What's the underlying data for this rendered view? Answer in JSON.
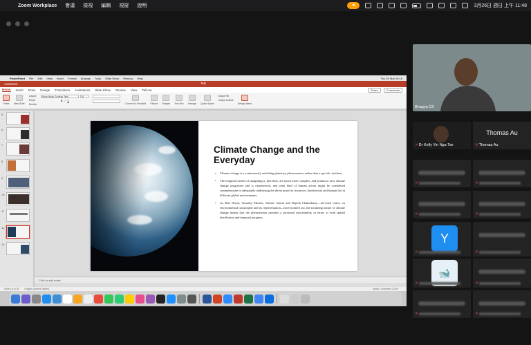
{
  "menubar": {
    "app": "Zoom Workplace",
    "items": [
      "會議",
      "檢視",
      "編輯",
      "視窗",
      "說明"
    ],
    "clock": "3月26日 週日 上午 11:48"
  },
  "powerpoint": {
    "app": "PowerPoint",
    "menus": [
      "File",
      "Edit",
      "View",
      "Insert",
      "Format",
      "Arrange",
      "Tools",
      "Slide Show",
      "Window",
      "Help"
    ],
    "clock": "Thu 20 Mar 09:18",
    "autosave": "AutoSave",
    "doc_title": "Talk",
    "tabs": [
      "Home",
      "Insert",
      "Draw",
      "Design",
      "Transitions",
      "Animations",
      "Slide Show",
      "Review",
      "View",
      "Tell me"
    ],
    "share": "Share",
    "comments": "Comments",
    "ribbon": [
      "Paste",
      "New Slide",
      "Layout",
      "Reset",
      "Section",
      "Convert to SmartArt",
      "Picture",
      "Shapes",
      "Text Box",
      "Arrange",
      "Quick Styles",
      "Shape Fill",
      "Shape Outline",
      "Design Ideas"
    ],
    "font_box": "Neue Haas Grotesk Text...",
    "font_size": "16",
    "slide_numbers": [
      "5",
      "6",
      "7",
      "8",
      "9",
      "10",
      "11",
      "12",
      "13"
    ],
    "notes_placeholder": "Click to add notes",
    "status_left": "Slide 16 of 28",
    "status_lang": "English (United States)",
    "status_notes": "Notes",
    "status_comments": "Comments",
    "zoom": "125%"
  },
  "slide": {
    "title": "Climate Change and the Everyday",
    "bullets": [
      "Climate change is a continuously unfolding planetary phenomenon, rather than a specific incident.",
      "The temporal modes of imagining it, therefore, are much more complex, and pertain to how climate change progresses and is experienced, and what kind of human action might be considered commensurate to adequately addressing the threat posed to resources, biodiversity and human life in different global environments.",
      "As Rob Nixon, Timothy Morton, Amitav Ghosh and Dipesh Chakrabarty—oft-cited critics on environmental catastrophe and its representation—have pointed out, the totalizing nature of climate change means that the phenomenon presents a profound unscalability in terms of both spatial distribution and temporal progress."
    ]
  },
  "participants": {
    "active_speaker": "Bhagya CS",
    "p2": "Dr Kelly Yin Nga Tse",
    "p3_header": "Thomas Au",
    "p3_name": "Thomas Au",
    "avatar_letter": "Y"
  }
}
